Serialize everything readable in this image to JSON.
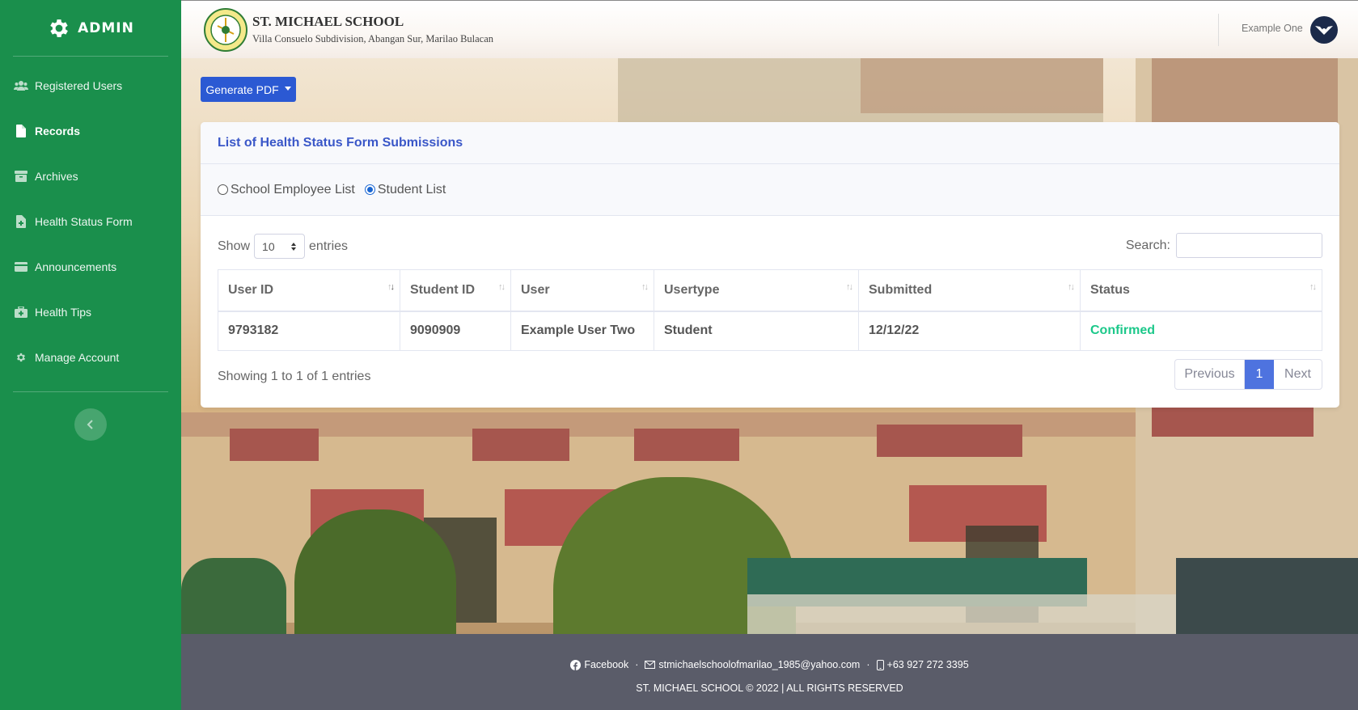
{
  "sidebar": {
    "brand": "ADMIN",
    "items": [
      {
        "label": "Registered Users",
        "icon": "users-icon"
      },
      {
        "label": "Records",
        "icon": "file-icon",
        "active": true
      },
      {
        "label": "Archives",
        "icon": "archive-icon"
      },
      {
        "label": "Health Status Form",
        "icon": "file-medical-icon"
      },
      {
        "label": "Announcements",
        "icon": "card-icon"
      },
      {
        "label": "Health Tips",
        "icon": "medkit-icon"
      },
      {
        "label": "Manage Account",
        "icon": "gear-icon"
      }
    ]
  },
  "header": {
    "school_name": "ST. MICHAEL SCHOOL",
    "school_address": "Villa Consuelo Subdivision, Abangan Sur, Marilao Bulacan",
    "user_name": "Example One"
  },
  "toolbar": {
    "generate_label": "Generate PDF"
  },
  "card": {
    "title": "List of Health Status Form Submissions",
    "filters": [
      {
        "label": "School Employee List",
        "checked": false
      },
      {
        "label": "Student List",
        "checked": true
      }
    ],
    "show_label": "Show",
    "entries_value": "10",
    "entries_label": "entries",
    "search_label": "Search:",
    "columns": [
      "User ID",
      "Student ID",
      "User",
      "Usertype",
      "Submitted",
      "Status"
    ],
    "rows": [
      [
        "9793182",
        "9090909",
        "Example User Two",
        "Student",
        "12/12/22",
        "Confirmed"
      ]
    ],
    "info": "Showing 1 to 1 of 1 entries",
    "pager": {
      "previous": "Previous",
      "page": "1",
      "next": "Next"
    }
  },
  "footer": {
    "facebook": "Facebook",
    "email": "stmichaelschoolofmarilao_1985@yahoo.com",
    "phone": "+63 927 272 3395",
    "copyright": "ST. MICHAEL SCHOOL © 2022 | ALL RIGHTS RESERVED"
  },
  "colors": {
    "sidebar": "#1a8f4c",
    "primary": "#2b59d3",
    "status_confirmed": "#1cc88a",
    "footer": "#5a5c69"
  }
}
